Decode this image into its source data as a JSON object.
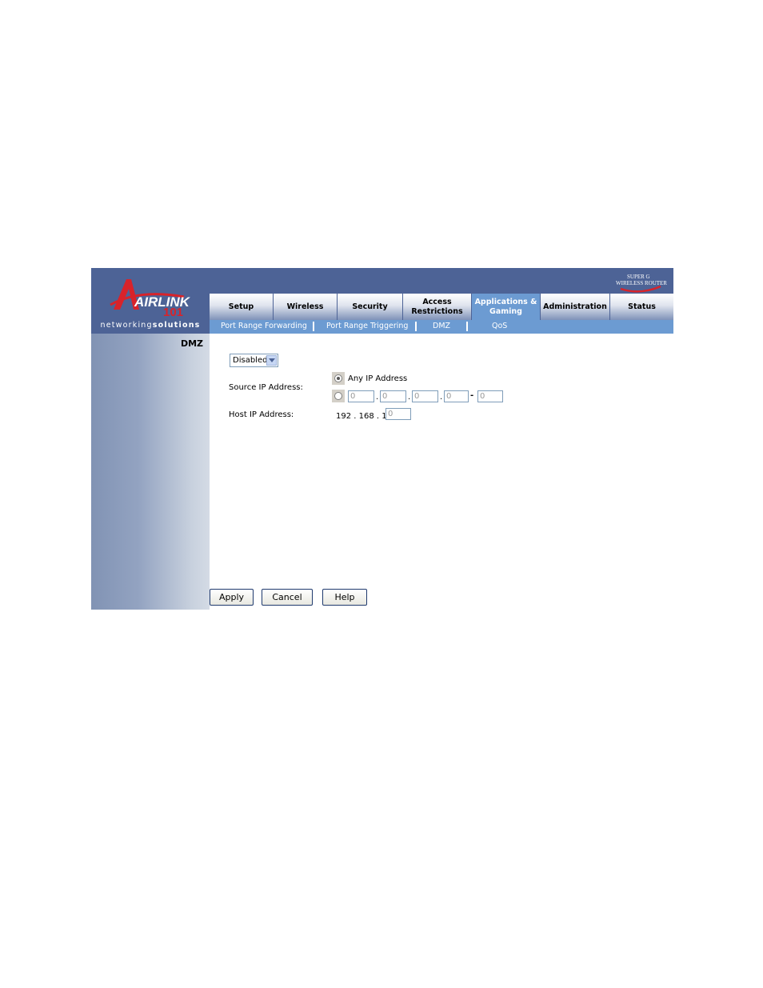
{
  "logo": {
    "brand_text": "AIRLINK",
    "brand_number": "101",
    "tagline_normal": "networking",
    "tagline_bold": "solutions"
  },
  "product_badge": {
    "line1": "SUPER G",
    "line2": "WIRELESS ROUTER"
  },
  "tabs": [
    {
      "label": "Setup",
      "active": false
    },
    {
      "label": "Wireless",
      "active": false
    },
    {
      "label": "Security",
      "active": false
    },
    {
      "label": "Access Restrictions",
      "active": false
    },
    {
      "label": "Applications & Gaming",
      "active": true
    },
    {
      "label": "Administration",
      "active": false
    },
    {
      "label": "Status",
      "active": false
    }
  ],
  "subnav": [
    {
      "label": "Port Range Forwarding"
    },
    {
      "label": "Port Range Triggering"
    },
    {
      "label": "DMZ"
    },
    {
      "label": "QoS"
    }
  ],
  "section_title": "DMZ",
  "dmz_mode": {
    "selected": "Disabled"
  },
  "source_ip": {
    "label": "Source IP Address:",
    "any_label": "Any IP Address",
    "any_selected": true,
    "range_octets": [
      "0",
      "0",
      "0",
      "0"
    ],
    "range_end": "0",
    "dash": "-"
  },
  "host_ip": {
    "label": "Host IP Address:",
    "prefix": "192 . 168 . 1 .",
    "last_octet": "0"
  },
  "buttons": {
    "apply": "Apply",
    "cancel": "Cancel",
    "help": "Help"
  },
  "colors": {
    "header_blue": "#4d6396",
    "active_tab": "#6c9bd2",
    "logo_red": "#d8232a"
  }
}
